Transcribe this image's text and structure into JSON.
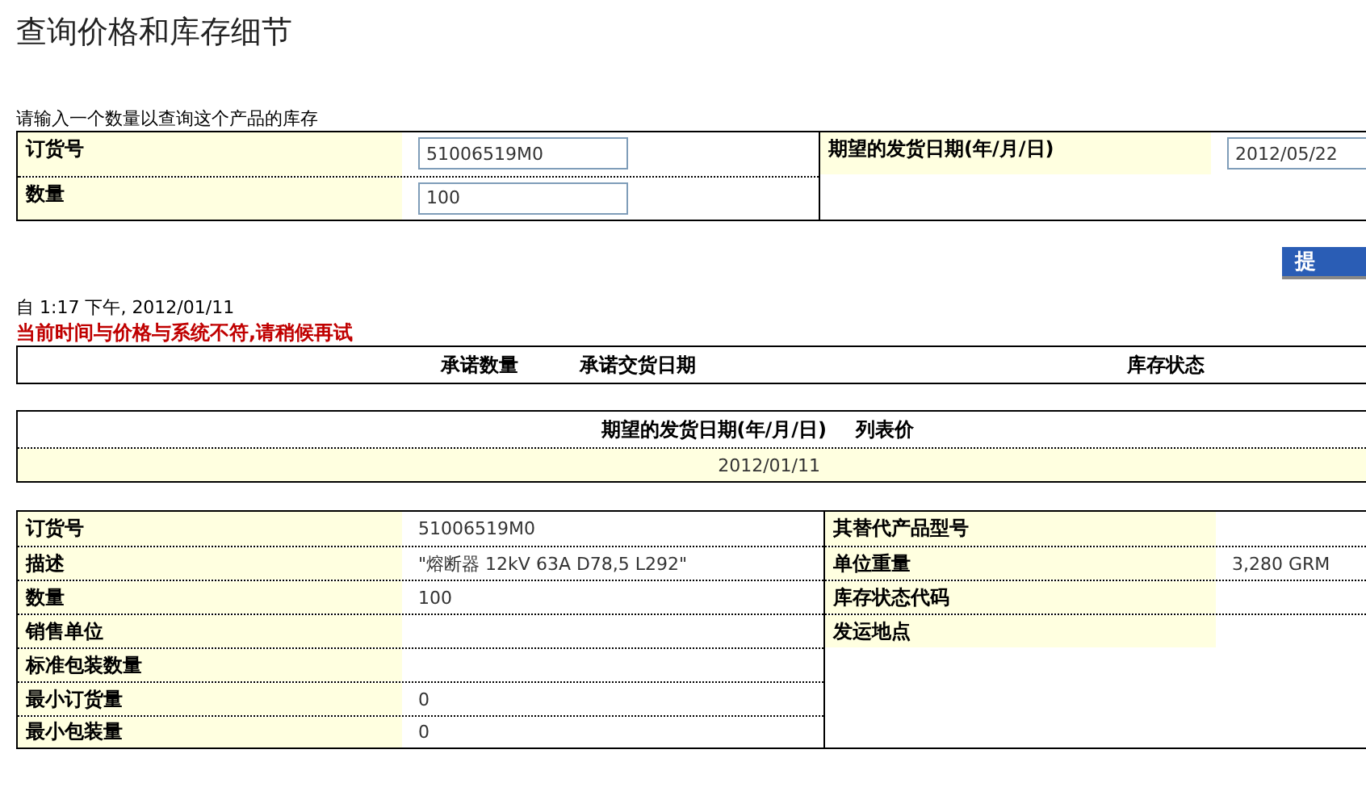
{
  "page_title": "查询价格和库存细节",
  "instruction": "请输入一个数量以查询这个产品的库存",
  "query_form": {
    "fields": [
      {
        "label": "订货号",
        "value": "51006519M0"
      },
      {
        "label": "数量",
        "value": "100"
      }
    ],
    "date_field": {
      "label": "期望的发货日期(年/月/日)",
      "value": "2012/05/22"
    }
  },
  "submit_button": "提",
  "timestamp": "自 1:17 下午, 2012/01/11",
  "error_message": "当前时间与价格与系统不符,请稍候再试",
  "availability_table": {
    "columns": [
      "承诺数量",
      "承诺交货日期",
      "库存状态"
    ]
  },
  "price_table": {
    "columns": [
      "期望的发货日期(年/月/日)",
      "列表价"
    ],
    "rows": [
      [
        "2012/01/11"
      ]
    ]
  },
  "product_details": {
    "left": [
      {
        "label": "订货号",
        "value": "51006519M0"
      },
      {
        "label": "描述",
        "value": "\"熔断器 12kV 63A D78,5 L292\""
      },
      {
        "label": "数量",
        "value": "100"
      },
      {
        "label": "销售单位"
      },
      {
        "label": "标准包装数量"
      },
      {
        "label": "最小订货量",
        "value": "0"
      },
      {
        "label": "最小包装量",
        "value": "0"
      }
    ],
    "right": [
      {
        "label": "其替代产品型号"
      },
      {
        "label": "单位重量",
        "value": "3,280 GRM"
      },
      {
        "label": "库存状态代码"
      },
      {
        "label": "发运地点"
      }
    ]
  }
}
